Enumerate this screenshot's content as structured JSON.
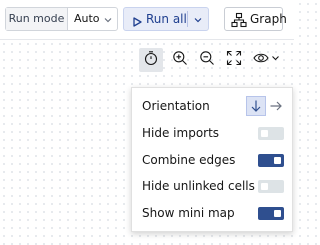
{
  "toolbar": {
    "run_mode_label": "Run mode",
    "run_mode_value": "Auto",
    "run_all_label": "Run all",
    "graph_label": "Graph"
  },
  "graph_tools": [
    {
      "icon": "timer-icon",
      "active": true
    },
    {
      "icon": "zoom-in-icon",
      "active": false
    },
    {
      "icon": "zoom-out-icon",
      "active": false
    },
    {
      "icon": "fit-to-screen-icon",
      "active": false
    },
    {
      "icon": "eye-icon",
      "active": false
    }
  ],
  "settings": {
    "orientation_label": "Orientation",
    "orientation_selected": "vertical",
    "options": [
      {
        "label": "Hide imports",
        "on": false
      },
      {
        "label": "Combine edges",
        "on": true
      },
      {
        "label": "Hide unlinked cells",
        "on": false
      },
      {
        "label": "Show mini map",
        "on": true
      }
    ]
  },
  "colors": {
    "accent": "#2f4f8f",
    "toggle_off": "#dde3e6",
    "run_all_bg": "#e8ecf8",
    "run_all_text": "#1f3f8f"
  }
}
